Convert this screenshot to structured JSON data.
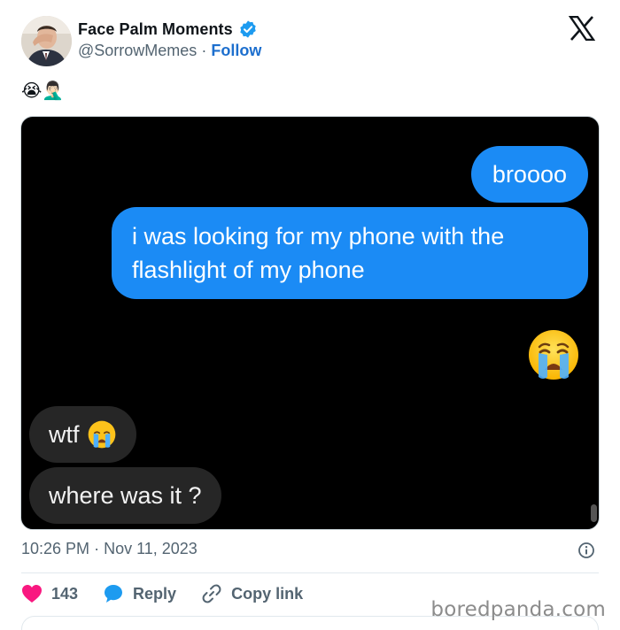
{
  "author": {
    "name": "Face Palm Moments",
    "handle": "@SorrowMemes",
    "separator": "·",
    "follow_label": "Follow"
  },
  "tweet": {
    "text": "😭🤦🏻‍♂️"
  },
  "media": {
    "messages": [
      {
        "side": "outgoing",
        "text": "broooo"
      },
      {
        "side": "outgoing",
        "text": "i was looking for my phone with the flashlight of my phone"
      },
      {
        "side": "outgoing",
        "emoji": "crying-face-icon"
      },
      {
        "side": "incoming",
        "text": "wtf",
        "emoji": "crying-face-icon"
      },
      {
        "side": "incoming",
        "text": "where was it ?"
      }
    ]
  },
  "meta": {
    "time": "10:26 PM",
    "date": "Nov 11, 2023",
    "separator": "·"
  },
  "actions": {
    "like_count": "143",
    "reply_label": "Reply",
    "copy_label": "Copy link"
  },
  "watermark": "boredpanda.com",
  "colors": {
    "outgoing_bubble": "#1b8bf5",
    "incoming_bubble": "#262626",
    "follow": "#1d6fce",
    "verified": "#1d9bf0",
    "like": "#f91880",
    "reply": "#1d9bf0"
  }
}
